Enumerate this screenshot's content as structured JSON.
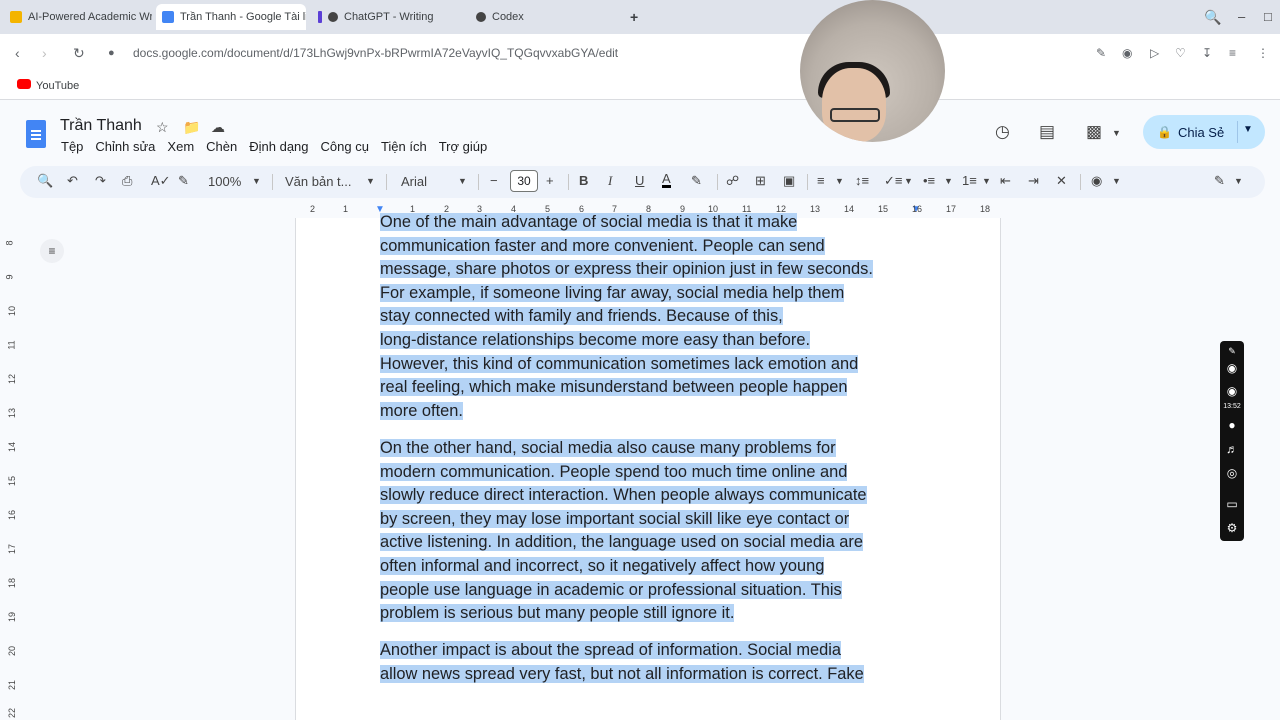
{
  "browser": {
    "tabs": [
      {
        "title": "AI-Powered Academic Wr",
        "color": "#f4b400"
      },
      {
        "title": "Trần Thanh - Google Tài liệ",
        "color": "#4285f4"
      },
      {
        "title": "ChatGPT - Writing",
        "color": "#444444"
      },
      {
        "title": "Codex",
        "color": "#444444"
      }
    ],
    "url": "docs.google.com/document/d/173LhGwj9vnPx-bRPwrmIA72eVayvIQ_TQGqvvxabGYA/edit",
    "bookmark": "YouTube"
  },
  "doc": {
    "title": "Trần Thanh",
    "menu": [
      "Tệp",
      "Chỉnh sửa",
      "Xem",
      "Chèn",
      "Định dạng",
      "Công cụ",
      "Tiện ích",
      "Trợ giúp"
    ],
    "share_label": "Chia Sẻ"
  },
  "toolbar": {
    "zoom": "100%",
    "style": "Văn bản t...",
    "font": "Arial",
    "font_size": "30"
  },
  "ruler": {
    "h_labels": [
      "2",
      "1",
      "1",
      "2",
      "3",
      "4",
      "5",
      "6",
      "7",
      "8",
      "9",
      "10",
      "11",
      "12",
      "13",
      "14",
      "15",
      "16",
      "17",
      "18"
    ],
    "v_labels": [
      "8",
      "9",
      "10",
      "11",
      "12",
      "13",
      "14",
      "15",
      "16",
      "17",
      "18",
      "19",
      "20",
      "21",
      "22"
    ]
  },
  "recorder": {
    "time": "13:52"
  },
  "content": {
    "p1": [
      "One of the main advantage of social media is that it make",
      "communication faster and more convenient. People can send",
      "message, share photos or express their opinion just in few seconds.",
      "For example, if someone living far away, social media help them",
      "stay connected with family and friends. Because of this,",
      "long-distance relationships become more easy than before.",
      "However, this kind of communication sometimes lack emotion and",
      "real feeling, which make misunderstand between people happen",
      "more often."
    ],
    "p2": [
      "On the other hand, social media also cause many problems for",
      "modern communication. People spend too much time online and",
      "slowly reduce direct interaction. When people always communicate",
      "by screen, they may lose important social skill like eye contact or",
      "active listening. In addition, the language used on social media are",
      "often informal and incorrect, so it negatively affect how young",
      "people use language in academic or professional situation. This",
      "problem is serious but many people still ignore it."
    ],
    "p3": [
      "Another impact is about the spread of information. Social media",
      "allow news spread very fast, but not all information is correct. Fake"
    ]
  }
}
